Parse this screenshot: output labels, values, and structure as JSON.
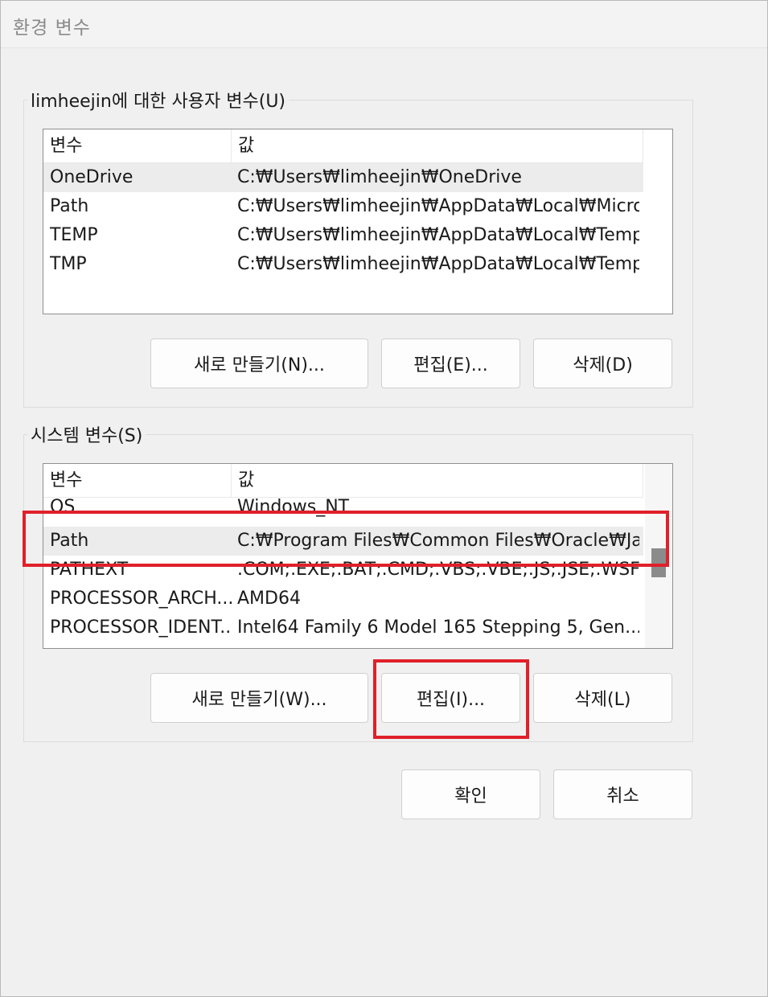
{
  "window": {
    "title": "환경 변수"
  },
  "user_vars": {
    "legend": "limheejin에 대한 사용자 변수(U)",
    "col_name": "변수",
    "col_value": "값",
    "rows": [
      {
        "name": "OneDrive",
        "value": "C:₩Users₩limheejin₩OneDrive"
      },
      {
        "name": "Path",
        "value": "C:₩Users₩limheejin₩AppData₩Local₩Micro..."
      },
      {
        "name": "TEMP",
        "value": "C:₩Users₩limheejin₩AppData₩Local₩Temp"
      },
      {
        "name": "TMP",
        "value": "C:₩Users₩limheejin₩AppData₩Local₩Temp"
      }
    ],
    "selected_row": "OneDrive",
    "new_label": "새로 만들기(N)...",
    "edit_label": "편집(E)...",
    "delete_label": "삭제(D)"
  },
  "system_vars": {
    "legend": "시스템 변수(S)",
    "col_name": "변수",
    "col_value": "값",
    "rows": [
      {
        "name": "OS",
        "value": "Windows_NT"
      },
      {
        "name": "Path",
        "value": "C:₩Program Files₩Common Files₩Oracle₩Ja..."
      },
      {
        "name": "PATHEXT",
        "value": ".COM;.EXE;.BAT;.CMD;.VBS;.VBE;.JS;.JSE;.WSF;...."
      },
      {
        "name": "PROCESSOR_ARCH...",
        "value": "AMD64"
      },
      {
        "name": "PROCESSOR_IDENT...",
        "value": "Intel64 Family 6 Model 165 Stepping 5, Gen..."
      }
    ],
    "selected_row": "Path",
    "new_label": "새로 만들기(W)...",
    "edit_label": "편집(I)...",
    "delete_label": "삭제(L)"
  },
  "footer": {
    "ok_label": "확인",
    "cancel_label": "취소"
  },
  "colors": {
    "highlight": "#e0202a",
    "selected_row": "#ececec",
    "background": "#f0f0f0"
  }
}
